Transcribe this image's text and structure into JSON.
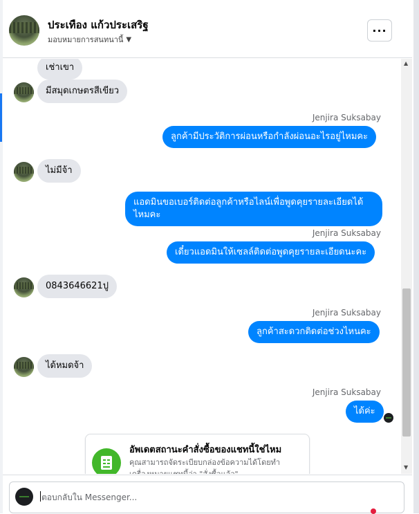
{
  "header": {
    "name": "ประเทือง แก้วประเสริฐ",
    "subtitle": "มอบหมายการสนทนานี้",
    "more_label": "···"
  },
  "messages": [
    {
      "direction": "in",
      "text": "เช่าเขา",
      "show_avatar": false
    },
    {
      "direction": "in",
      "text": "มีสมุดเกษตรสีเขียว",
      "show_avatar": true
    },
    {
      "direction": "out",
      "sender": "Jenjira Suksabay",
      "text": "ลูกค้ามีประวัติการผ่อนหรือกำลังผ่อนอะไรอยู่ไหมคะ"
    },
    {
      "direction": "in",
      "text": "ไม่มีจ้า",
      "show_avatar": true
    },
    {
      "direction": "out",
      "text": "แอดมินขอเบอร์ติดต่อลูกค้าหรือไลน์เพื่อพูดคุยรายละเอียดได้ไหมคะ"
    },
    {
      "direction": "out",
      "sender": "Jenjira Suksabay",
      "text": "เดี๋ยวแอดมินให้เซลล์ติดต่อพูดคุยรายละเอียดนะคะ"
    },
    {
      "direction": "in",
      "text": "0843646621ปู",
      "show_avatar": true
    },
    {
      "direction": "out",
      "sender": "Jenjira Suksabay",
      "text": "ลูกค้าสะดวกติดต่อช่วงไหนคะ"
    },
    {
      "direction": "in",
      "text": "ได้หมดจ้า",
      "show_avatar": true
    },
    {
      "direction": "out",
      "sender": "Jenjira Suksabay",
      "text": "ได้ค่ะ",
      "seen": true
    }
  ],
  "update_card": {
    "title": "อัพเดตสถานะคำสั่งซื้อของแชทนี้ใช่ไหม",
    "description": "คุณสามารถจัดระเบียบกล่องข้อความได้โดยทำเครื่องหมายแชทนี้ว่า \"สั่งซื้อแล้ว\""
  },
  "composer": {
    "placeholder": "ตอบกลับใน Messenger..."
  },
  "colors": {
    "outgoing_bubble": "#0084ff",
    "incoming_bubble": "#e4e6eb",
    "card_icon": "#42b72a"
  }
}
